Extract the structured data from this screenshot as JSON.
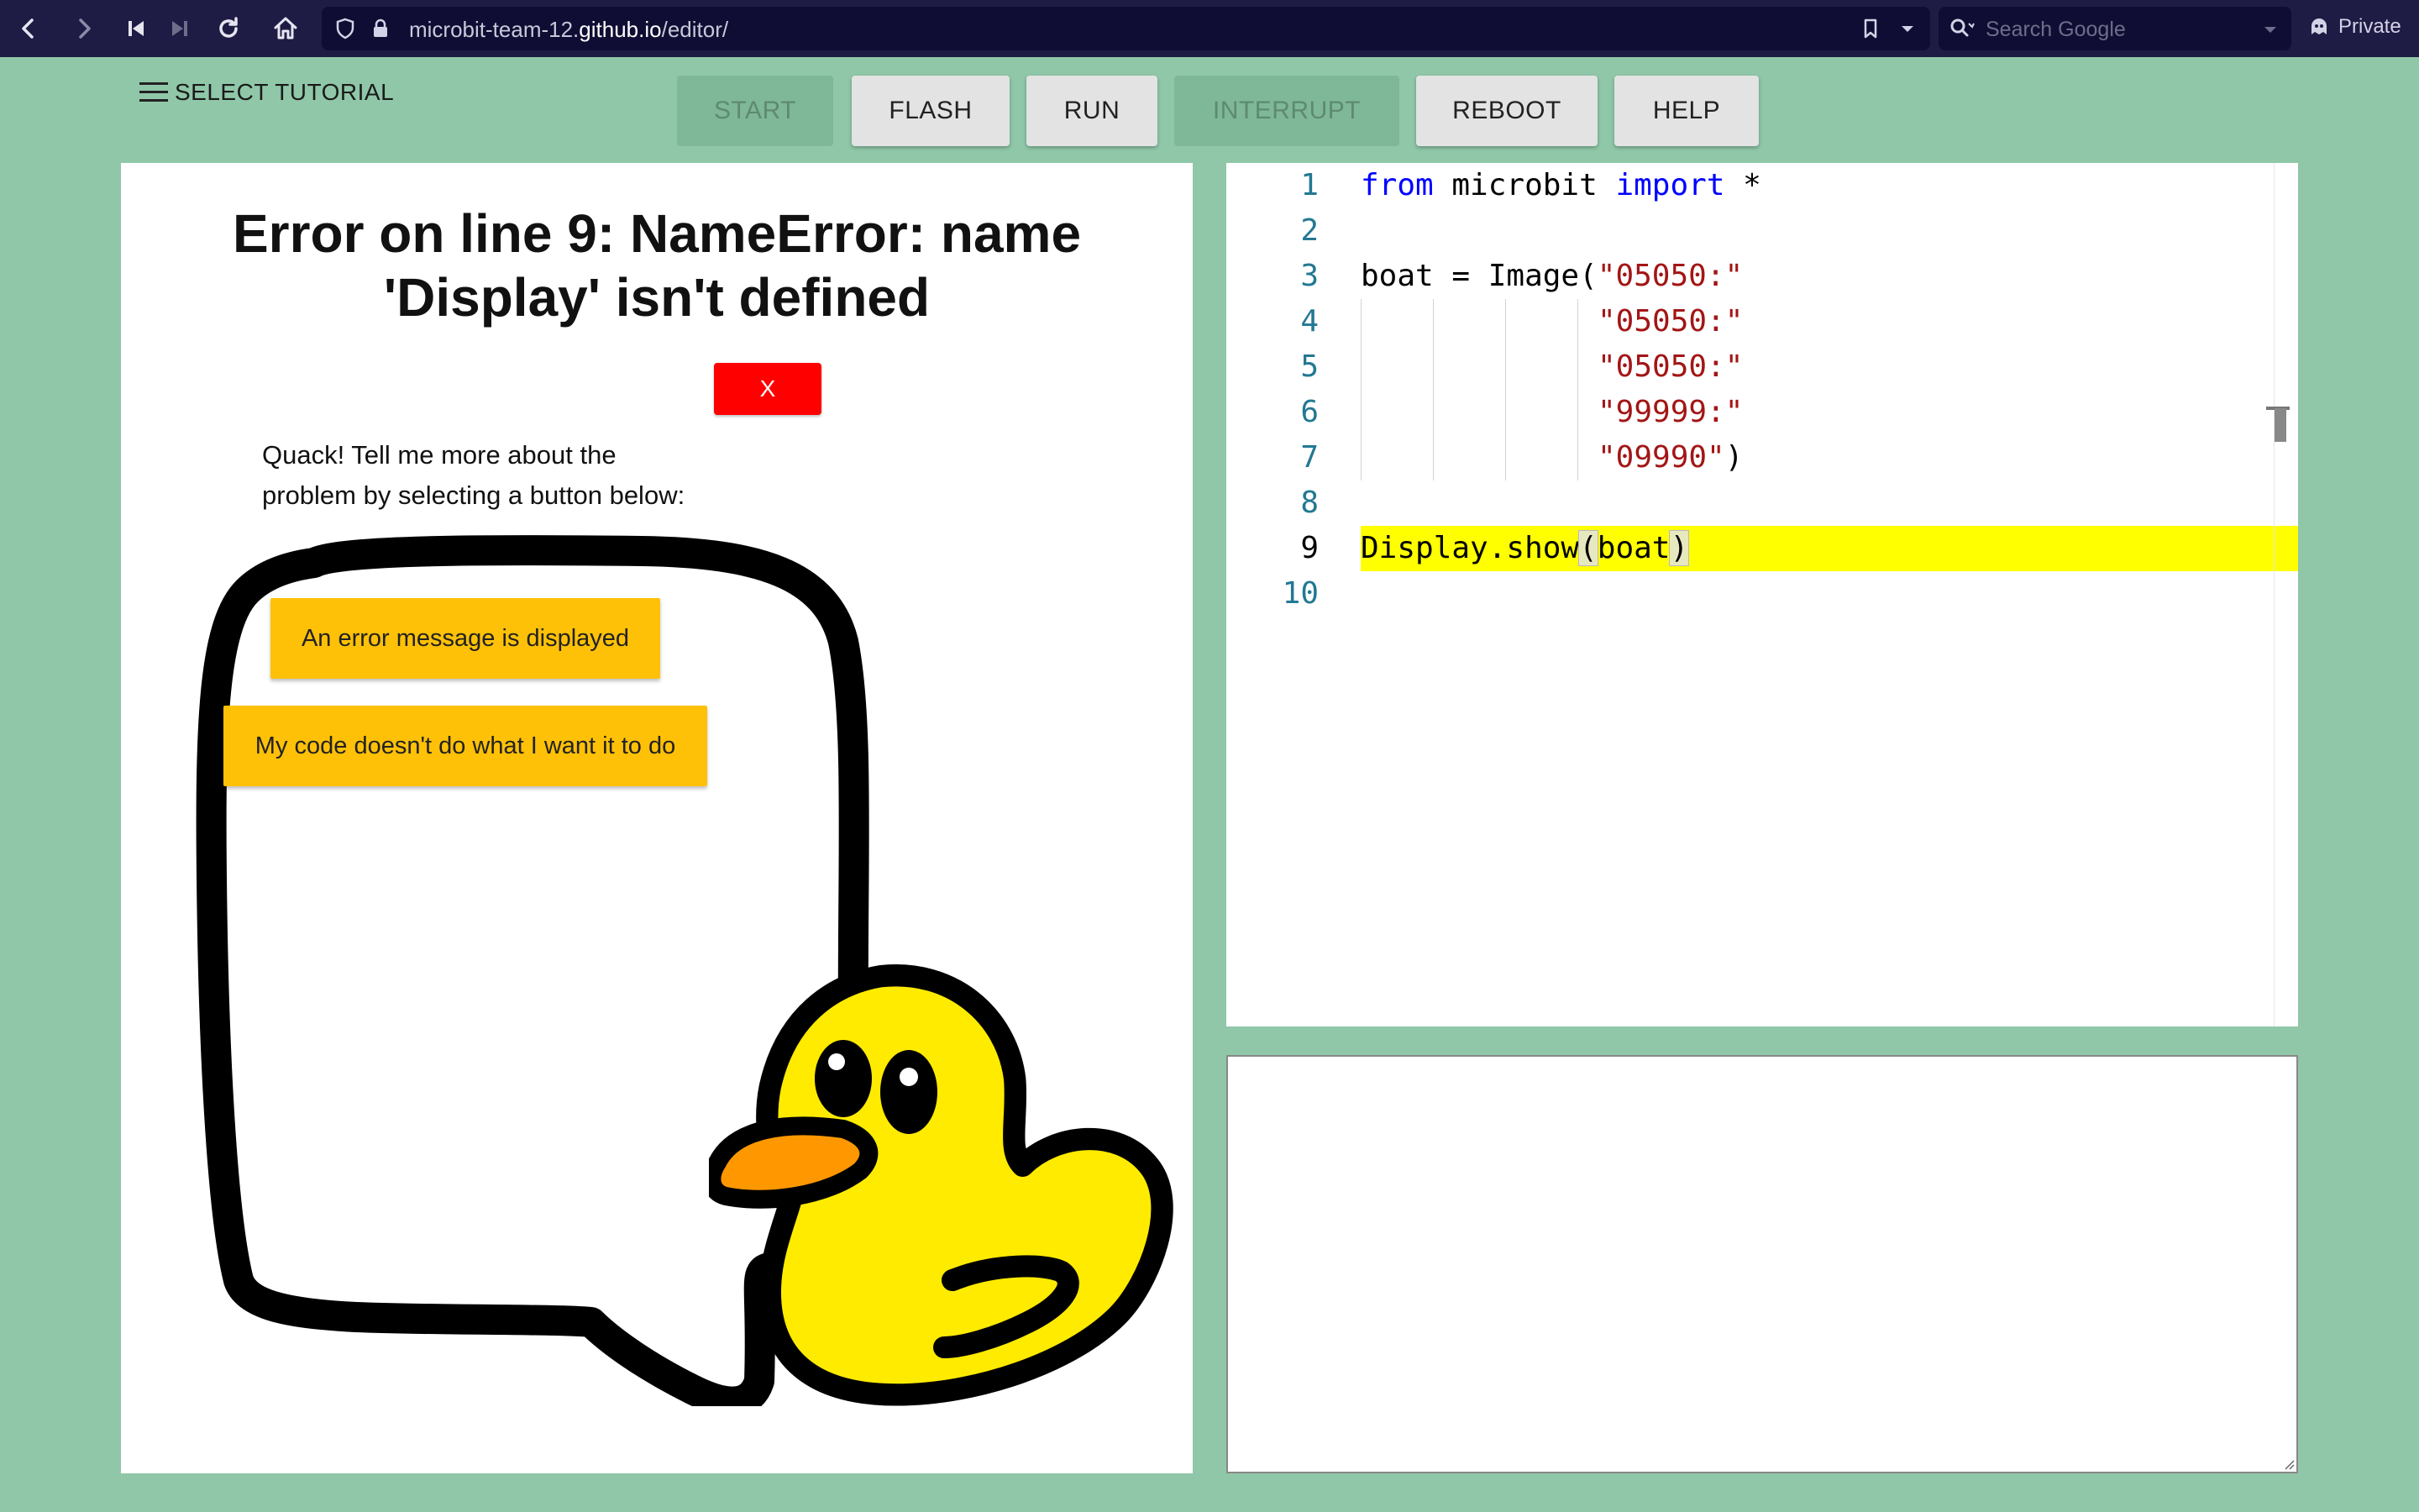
{
  "browser": {
    "url_path_prefix": "microbit-team-12.",
    "url_host": "github.io",
    "url_path": "/editor/",
    "search_placeholder": "Search Google",
    "private_label": "Private"
  },
  "toolbar": {
    "tutorial_label": "SELECT TUTORIAL",
    "buttons": [
      {
        "label": "START",
        "enabled": false
      },
      {
        "label": "FLASH",
        "enabled": true
      },
      {
        "label": "RUN",
        "enabled": true
      },
      {
        "label": "INTERRUPT",
        "enabled": false
      },
      {
        "label": "REBOOT",
        "enabled": true
      },
      {
        "label": "HELP",
        "enabled": true
      }
    ]
  },
  "assistant": {
    "error_title": "Error on line 9: NameError: name 'Display' isn't defined",
    "close_label": "X",
    "prompt": "Quack! Tell me more about the problem by selecting a button below:",
    "options": [
      "An error message is displayed",
      "My code doesn't do what I want it to do"
    ]
  },
  "editor": {
    "highlighted_line": 9,
    "line_numbers": [
      "1",
      "2",
      "3",
      "4",
      "5",
      "6",
      "7",
      "8",
      "9",
      "10"
    ],
    "lines": {
      "l1_from": "from",
      "l1_mid": " microbit ",
      "l1_import": "import",
      "l1_end": " *",
      "l3_pre": "boat = Image(",
      "l3_str": "\"05050:\"",
      "l4_str": "\"05050:\"",
      "l5_str": "\"05050:\"",
      "l6_str": "\"99999:\"",
      "l7_str": "\"09990\"",
      "l7_end": ")",
      "l9_pre": "Display.show",
      "l9_open": "(",
      "l9_arg": "boat",
      "l9_close": ")"
    }
  },
  "output": {
    "content": ""
  },
  "colors": {
    "page_bg": "#8fc7a8",
    "chrome_bg": "#1e1b45",
    "close_button": "#ff0000",
    "option_button": "#ffc107",
    "line_highlight": "#ffff00",
    "keyword": "#0000ff",
    "string": "#a31515",
    "line_number": "#237893"
  }
}
